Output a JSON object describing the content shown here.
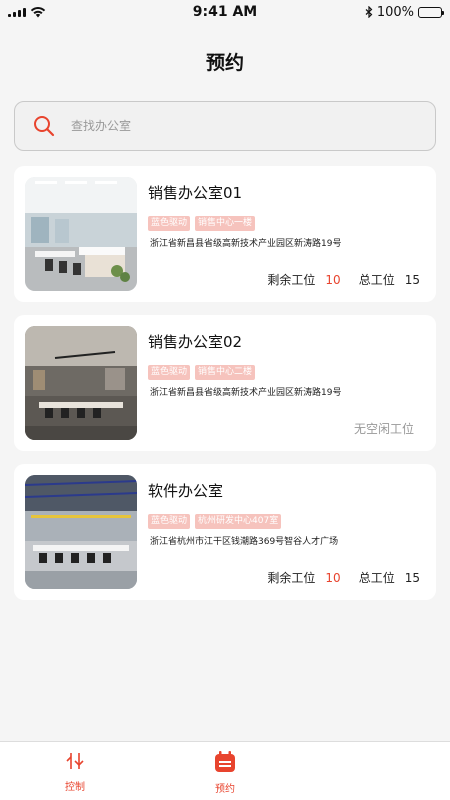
{
  "status": {
    "time": "9:41 AM",
    "battery": "100%"
  },
  "page": {
    "title": "预约"
  },
  "search": {
    "placeholder": "查找办公室"
  },
  "offices": [
    {
      "name": "销售办公室01",
      "tags": [
        "蓝色驱动",
        "销售中心一楼"
      ],
      "address": "浙江省新昌县省级高新技术产业园区新涛路19号",
      "remaining_label": "剩余工位",
      "remaining": "10",
      "total_label": "总工位",
      "total": "15"
    },
    {
      "name": "销售办公室02",
      "tags": [
        "蓝色驱动",
        "销售中心二楼"
      ],
      "address": "浙江省新昌县省级高新技术产业园区新涛路19号",
      "no_seat": "无空闲工位"
    },
    {
      "name": "软件办公室",
      "tags": [
        "蓝色驱动",
        "杭州研发中心407室"
      ],
      "address": "浙江省杭州市江干区钱潮路369号智谷人才广场",
      "remaining_label": "剩余工位",
      "remaining": "10",
      "total_label": "总工位",
      "total": "15"
    }
  ],
  "tabbar": {
    "tabs": [
      {
        "label": "控制",
        "icon": "control-icon"
      },
      {
        "label": "预约",
        "icon": "calendar-icon"
      }
    ],
    "active_color": "#e8442e"
  }
}
